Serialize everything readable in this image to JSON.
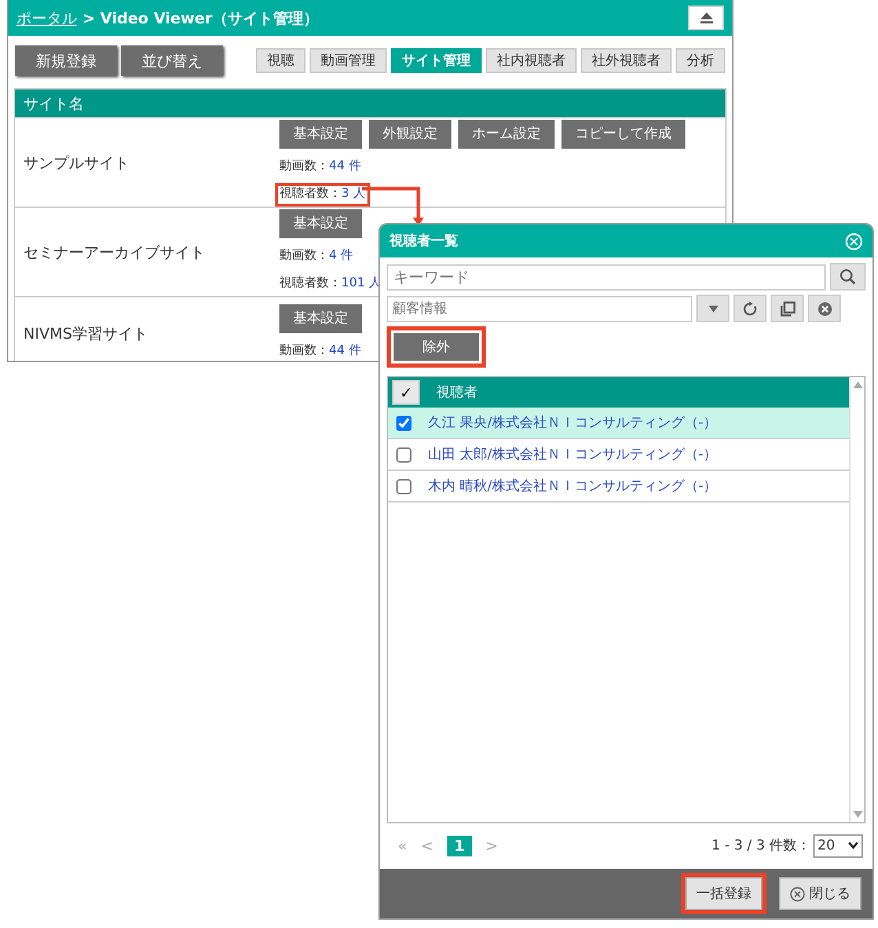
{
  "window": {
    "breadcrumb_link": "ポータル",
    "title": " > Video Viewer（サイト管理）"
  },
  "actions": [
    "新規登録",
    "並び替え"
  ],
  "tabs": [
    {
      "label": "視聴",
      "selected": false
    },
    {
      "label": "動画管理",
      "selected": false
    },
    {
      "label": "サイト管理",
      "selected": true
    },
    {
      "label": "社内視聴者",
      "selected": false
    },
    {
      "label": "社外視聴者",
      "selected": false
    },
    {
      "label": "分析",
      "selected": false
    }
  ],
  "table": {
    "column": "サイト名",
    "rows": [
      {
        "name": "サンプルサイト",
        "buttons": [
          "基本設定",
          "外観設定",
          "ホーム設定",
          "コピーして作成"
        ],
        "stats": [
          {
            "label": "動画数：",
            "value": "44 件",
            "highlighted": false
          },
          {
            "label": "視聴者数：",
            "value": "3 人",
            "highlighted": true
          }
        ]
      },
      {
        "name": "セミナーアーカイブサイト",
        "buttons": [
          "基本設定"
        ],
        "stats": [
          {
            "label": "動画数：",
            "value": "4 件",
            "highlighted": false
          },
          {
            "label": "視聴者数：",
            "value": "101 人",
            "highlighted": false
          }
        ]
      },
      {
        "name": "NIVMS学習サイト",
        "buttons": [
          "基本設定"
        ],
        "stats": [
          {
            "label": "動画数：",
            "value": "44 件",
            "highlighted": false
          }
        ]
      }
    ]
  },
  "dialog": {
    "title": "視聴者一覧",
    "keyword": {
      "placeholder": "キーワード"
    },
    "customer": {
      "placeholder": "顧客情報"
    },
    "exclude_button": {
      "label": "除外",
      "highlighted": true
    },
    "list": {
      "check_all": "✓",
      "column": "視聴者",
      "rows": [
        {
          "text": "久江 果央/株式会社ＮＩコンサルティング（-）",
          "checked": true,
          "selected": true
        },
        {
          "text": "山田 太郎/株式会社ＮＩコンサルティング（-）",
          "checked": false,
          "selected": false
        },
        {
          "text": "木内 晴秋/株式会社ＮＩコンサルティング（-）",
          "checked": false,
          "selected": false
        }
      ]
    },
    "pager": {
      "first": "«",
      "prev": "<",
      "pages": [
        {
          "label": "1",
          "selected": true
        }
      ],
      "next": ">",
      "summary": "1 - 3 / 3 件数：",
      "page_size": "20"
    },
    "footer": [
      {
        "label": "一括登録",
        "kind": "register",
        "highlighted": true
      },
      {
        "label": "閉じる",
        "kind": "close",
        "highlighted": false
      }
    ]
  }
}
